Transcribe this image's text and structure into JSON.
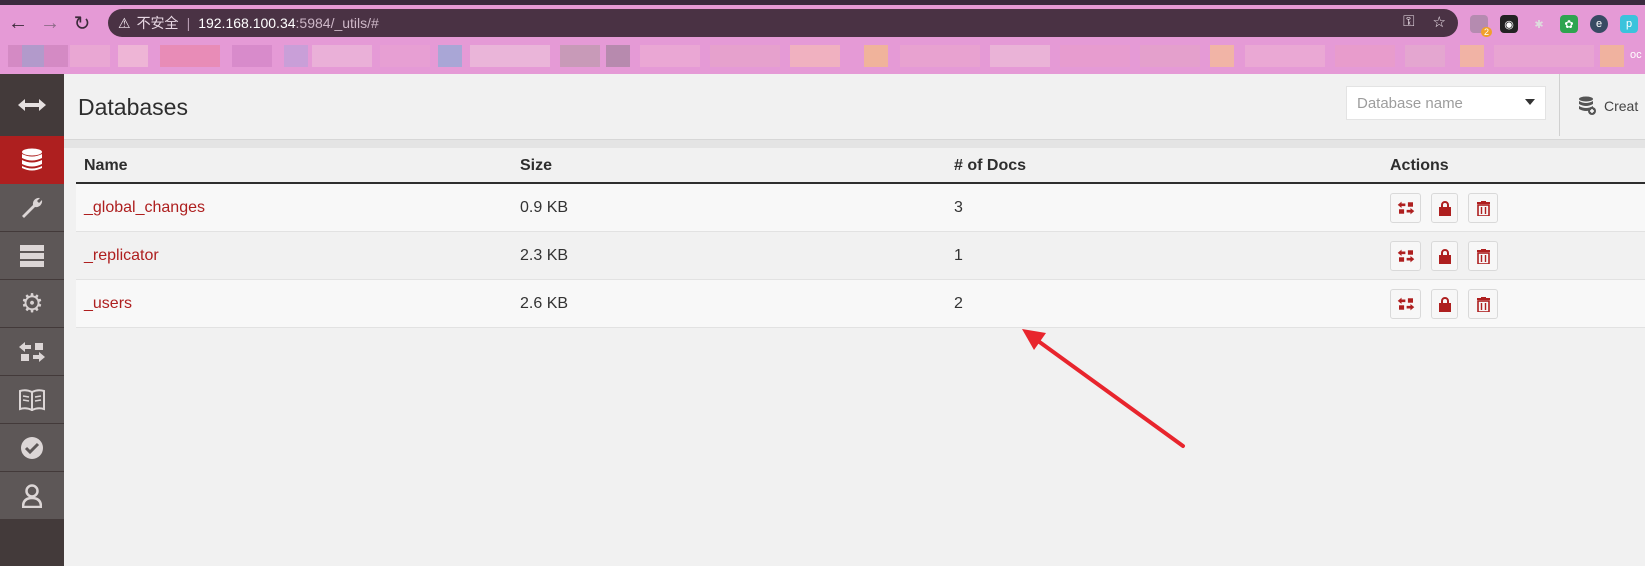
{
  "browser": {
    "insecure_label": "不安全",
    "url_host": "192.168.100.34",
    "url_path": ":5984/_utils/#",
    "ext_badge": "2",
    "edge_text": "oc"
  },
  "sidebar": {
    "items": [
      {
        "icon": "collapse-arrows-icon"
      },
      {
        "icon": "database-icon",
        "active": true
      },
      {
        "icon": "wrench-icon"
      },
      {
        "icon": "server-stack-icon"
      },
      {
        "icon": "gear-icon"
      },
      {
        "icon": "replication-icon"
      },
      {
        "icon": "book-icon"
      },
      {
        "icon": "check-circle-icon"
      },
      {
        "icon": "user-icon"
      }
    ]
  },
  "header": {
    "title": "Databases",
    "search_placeholder": "Database name",
    "create_label": "Creat"
  },
  "table": {
    "columns": [
      "Name",
      "Size",
      "# of Docs",
      "Actions"
    ],
    "rows": [
      {
        "name": "_global_changes",
        "size": "0.9 KB",
        "docs": "3"
      },
      {
        "name": "_replicator",
        "size": "2.3 KB",
        "docs": "1"
      },
      {
        "name": "_users",
        "size": "2.6 KB",
        "docs": "2"
      }
    ]
  },
  "colors": {
    "accent": "#ae1f1f",
    "sidebar": "#433a3a",
    "annotation_arrow": "#e8252d"
  }
}
